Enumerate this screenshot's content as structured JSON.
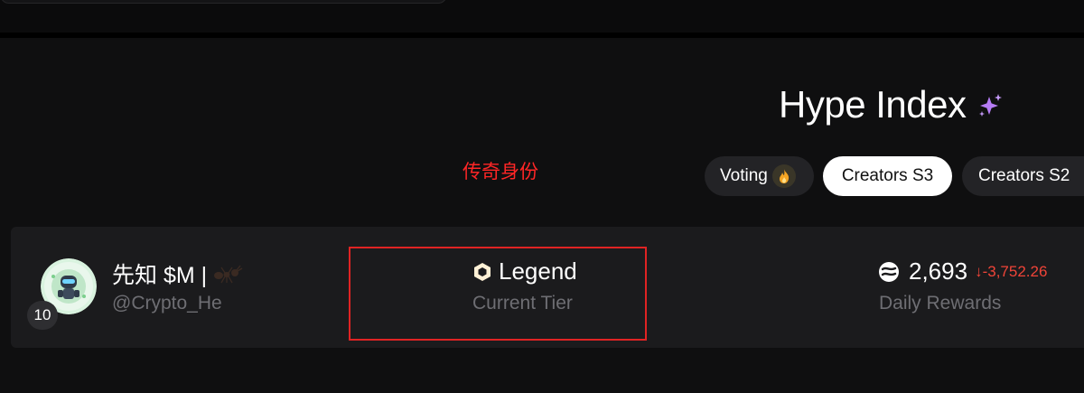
{
  "header": {
    "title": "Hype Index",
    "title_icon": "sparkle-icon",
    "accent_color": "#b67cf5"
  },
  "annotation": {
    "text": "传奇身份",
    "color": "#ff2626"
  },
  "tabs": [
    {
      "label": "Voting",
      "icon": "flame-icon",
      "active": false
    },
    {
      "label": "Creators S3",
      "active": true
    },
    {
      "label": "Creators S2",
      "active": false
    }
  ],
  "entry": {
    "rank": "10",
    "name": "先知 $M |",
    "name_icon": "ant-icon",
    "handle": "@Crypto_He",
    "tier": {
      "value": "Legend",
      "icon": "hexagon-icon",
      "label": "Current Tier"
    },
    "rewards": {
      "amount": "2,693",
      "change": "↓-3,752.26",
      "label": "Daily Rewards",
      "icon": "token-icon",
      "change_color": "#f04438"
    }
  },
  "highlight_color": "#e02323"
}
